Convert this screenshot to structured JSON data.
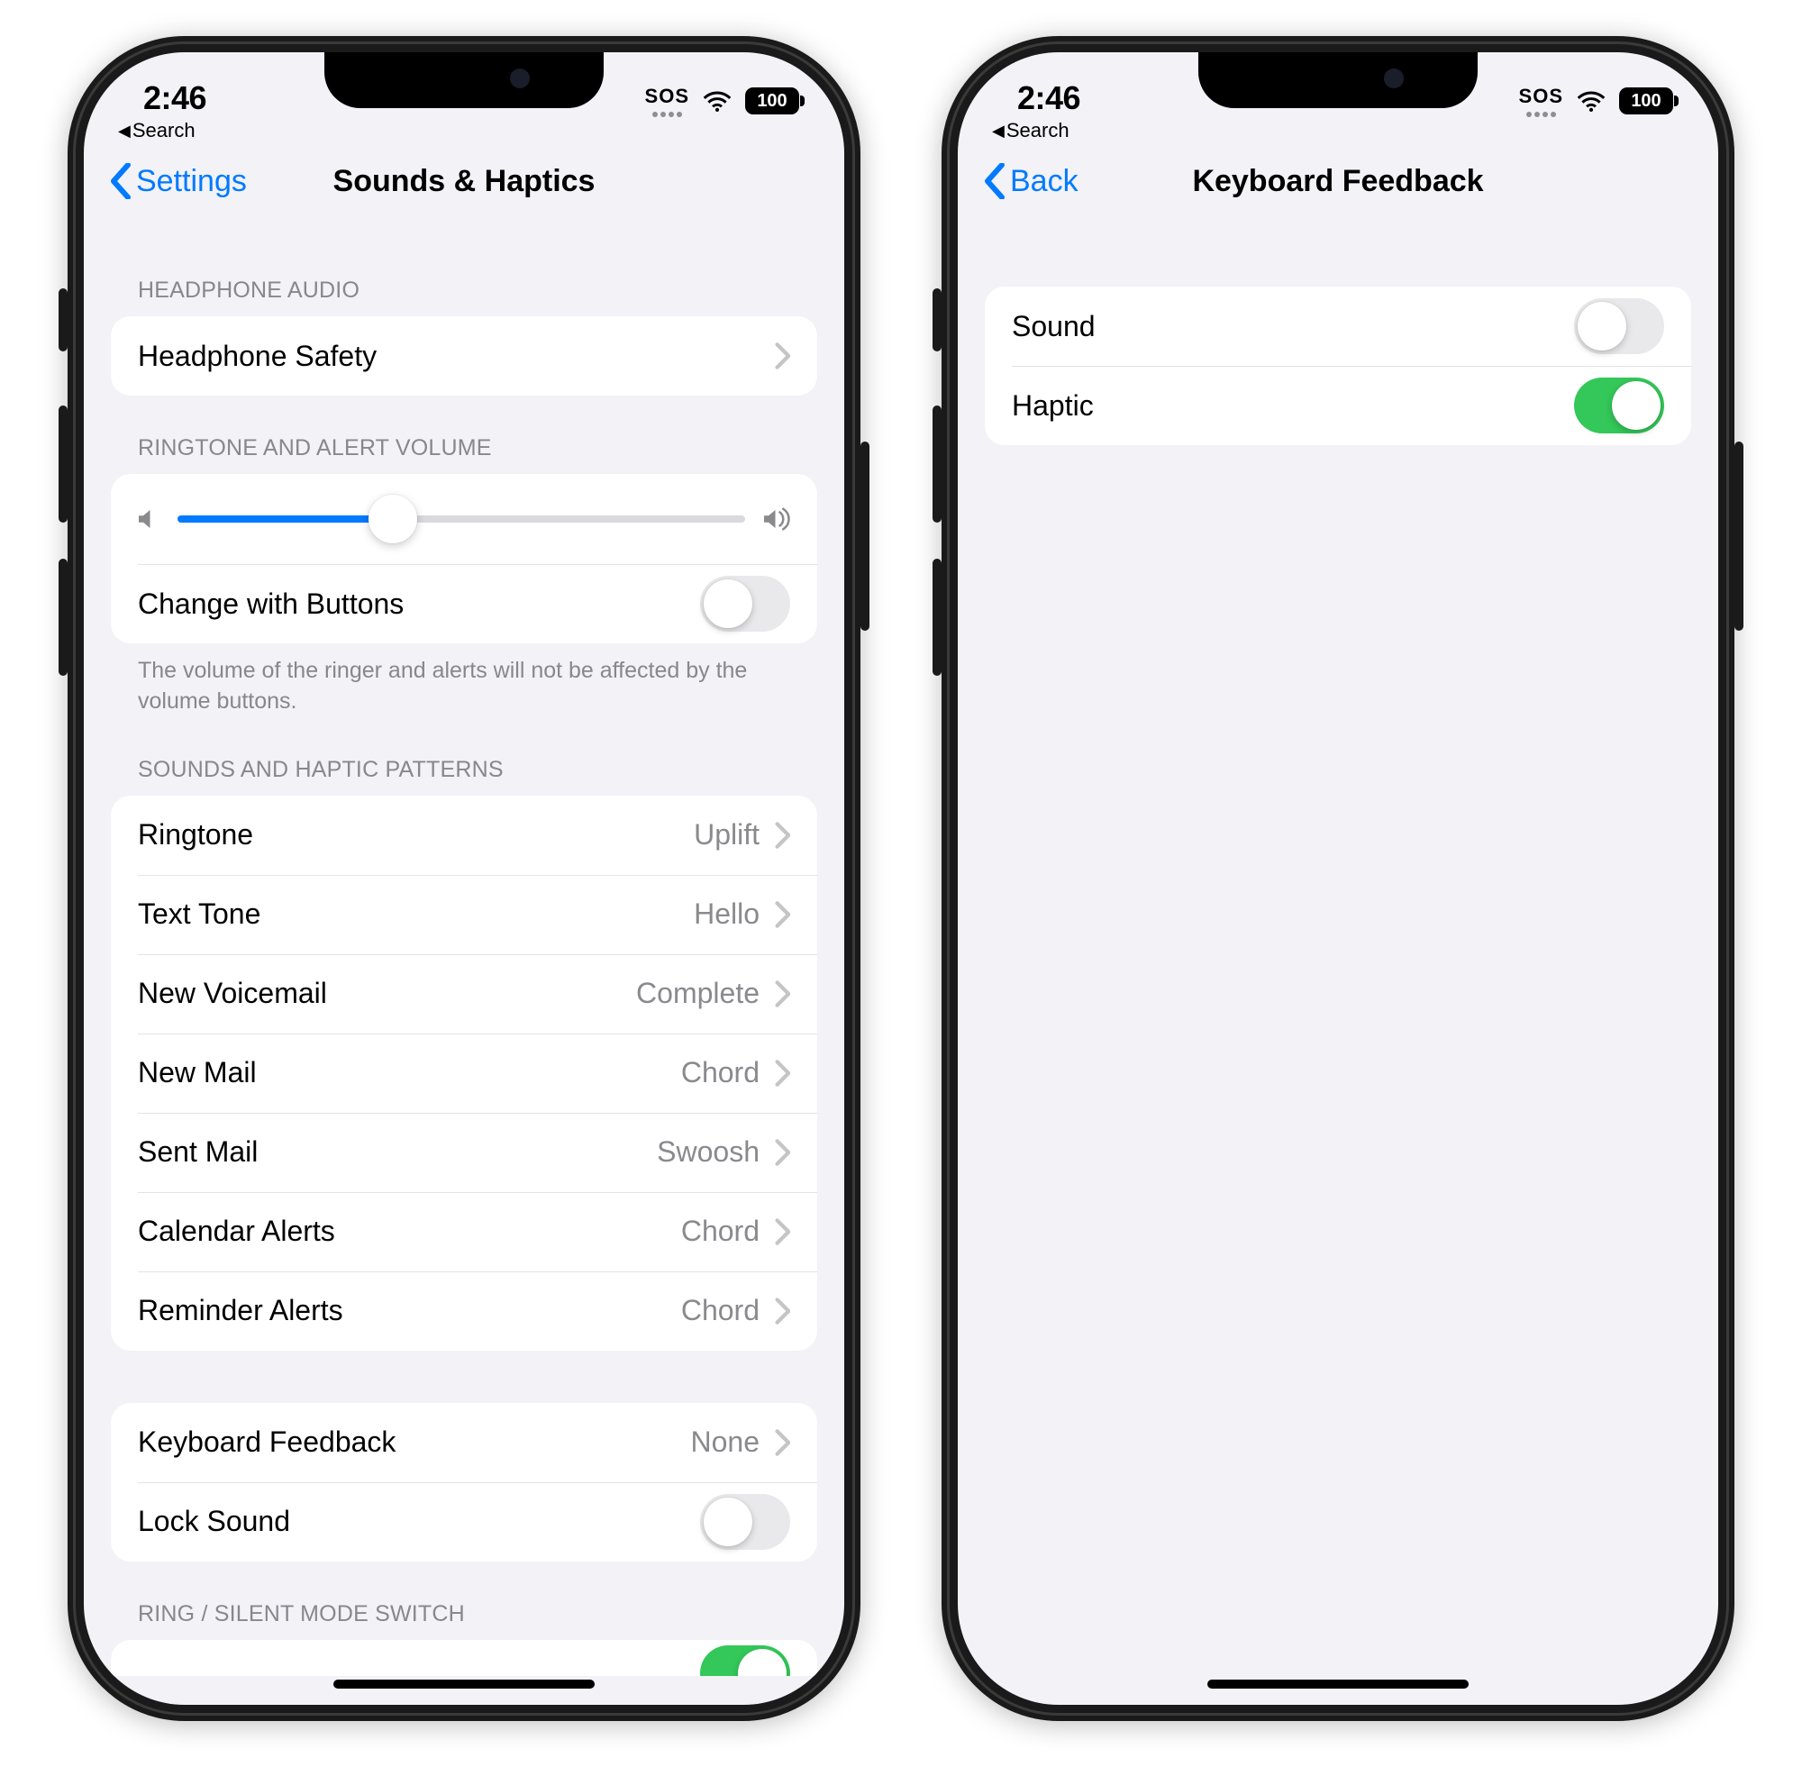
{
  "status": {
    "time": "2:46",
    "breadcrumb": "Search",
    "sos": "SOS",
    "battery": "100"
  },
  "left": {
    "back": "Settings",
    "title": "Sounds & Haptics",
    "headphone_header": "HEADPHONE AUDIO",
    "headphone_safety": "Headphone Safety",
    "volume_header": "RINGTONE AND ALERT VOLUME",
    "volume_pct": 38,
    "change_with_buttons": "Change with Buttons",
    "change_with_buttons_on": false,
    "volume_footer": "The volume of the ringer and alerts will not be affected by the volume buttons.",
    "patterns_header": "SOUNDS AND HAPTIC PATTERNS",
    "patterns": [
      {
        "label": "Ringtone",
        "value": "Uplift"
      },
      {
        "label": "Text Tone",
        "value": "Hello"
      },
      {
        "label": "New Voicemail",
        "value": "Complete"
      },
      {
        "label": "New Mail",
        "value": "Chord"
      },
      {
        "label": "Sent Mail",
        "value": "Swoosh"
      },
      {
        "label": "Calendar Alerts",
        "value": "Chord"
      },
      {
        "label": "Reminder Alerts",
        "value": "Chord"
      }
    ],
    "keyboard_feedback_label": "Keyboard Feedback",
    "keyboard_feedback_value": "None",
    "lock_sound_label": "Lock Sound",
    "lock_sound_on": false,
    "ring_mode_header": "RING / SILENT MODE SWITCH"
  },
  "right": {
    "back": "Back",
    "title": "Keyboard Feedback",
    "rows": [
      {
        "label": "Sound",
        "on": false
      },
      {
        "label": "Haptic",
        "on": true
      }
    ]
  }
}
